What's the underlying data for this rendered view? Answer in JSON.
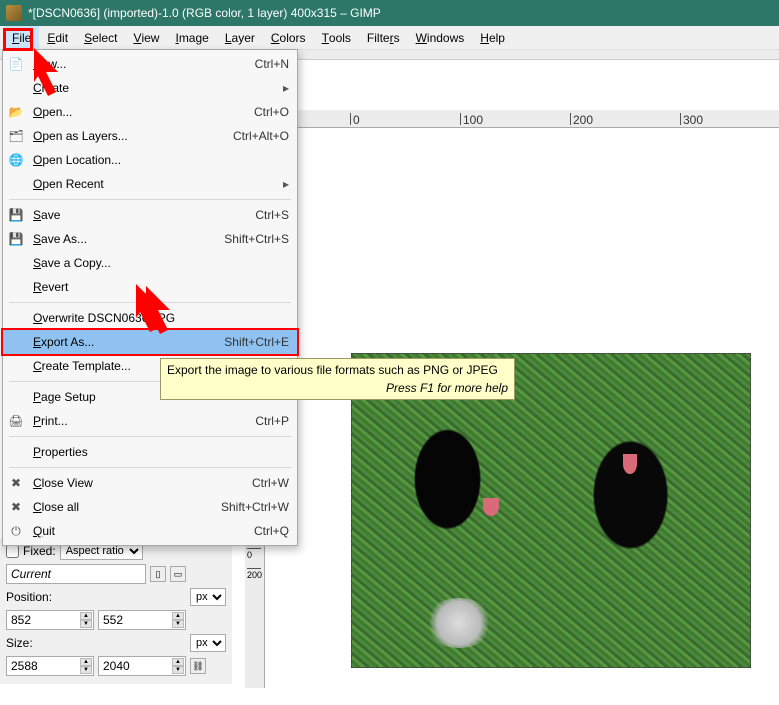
{
  "titlebar": {
    "title": "*[DSCN0636] (imported)-1.0 (RGB color, 1 layer) 400x315 – GIMP"
  },
  "menubar": {
    "items": [
      {
        "key": "F",
        "label": "File"
      },
      {
        "key": "E",
        "label": "Edit"
      },
      {
        "key": "S",
        "label": "Select"
      },
      {
        "key": "V",
        "label": "View"
      },
      {
        "key": "I",
        "label": "Image"
      },
      {
        "key": "L",
        "label": "Layer"
      },
      {
        "key": "C",
        "label": "Colors"
      },
      {
        "key": "T",
        "label": "Tools"
      },
      {
        "key": "r",
        "label": "Filters"
      },
      {
        "key": "W",
        "label": "Windows"
      },
      {
        "key": "H",
        "label": "Help"
      }
    ]
  },
  "file_menu": {
    "items": [
      {
        "icon": "doc",
        "label": "New...",
        "shortcut": "Ctrl+N"
      },
      {
        "icon": "",
        "label": "Create",
        "submenu": true
      },
      {
        "icon": "open",
        "label": "Open...",
        "shortcut": "Ctrl+O"
      },
      {
        "icon": "layers",
        "label": "Open as Layers...",
        "shortcut": "Ctrl+Alt+O"
      },
      {
        "icon": "globe",
        "label": "Open Location..."
      },
      {
        "icon": "",
        "label": "Open Recent",
        "submenu": true
      },
      {
        "sep": true
      },
      {
        "icon": "save",
        "label": "Save",
        "shortcut": "Ctrl+S"
      },
      {
        "icon": "saveas",
        "label": "Save As...",
        "shortcut": "Shift+Ctrl+S"
      },
      {
        "icon": "",
        "label": "Save a Copy..."
      },
      {
        "icon": "",
        "label": "Revert"
      },
      {
        "sep": true
      },
      {
        "icon": "",
        "label": "Overwrite DSCN0636.JPG"
      },
      {
        "icon": "",
        "label": "Export As...",
        "shortcut": "Shift+Ctrl+E",
        "highlight": true
      },
      {
        "icon": "",
        "label": "Create Template..."
      },
      {
        "sep": true
      },
      {
        "icon": "",
        "label": "Page Setup"
      },
      {
        "icon": "print",
        "label": "Print...",
        "shortcut": "Ctrl+P"
      },
      {
        "sep": true
      },
      {
        "icon": "",
        "label": "Properties"
      },
      {
        "sep": true
      },
      {
        "icon": "close",
        "label": "Close View",
        "shortcut": "Ctrl+W"
      },
      {
        "icon": "closeall",
        "label": "Close all",
        "shortcut": "Shift+Ctrl+W"
      },
      {
        "icon": "quit",
        "label": "Quit",
        "shortcut": "Ctrl+Q"
      }
    ]
  },
  "tooltip": {
    "text": "Export the image to various file formats such as PNG or JPEG",
    "help": "Press F1 for more help"
  },
  "ruler_h": [
    "0",
    "100",
    "200",
    "300"
  ],
  "ruler_v": [
    "0",
    "200"
  ],
  "left_panel": {
    "fixed_label": "Fixed:",
    "fixed_value": "Aspect ratio",
    "current_label": "Current",
    "position_label": "Position:",
    "unit1": "px",
    "pos_x": "852",
    "pos_y": "552",
    "size_label": "Size:",
    "unit2": "px",
    "size_w": "2588",
    "size_h": "2040"
  }
}
